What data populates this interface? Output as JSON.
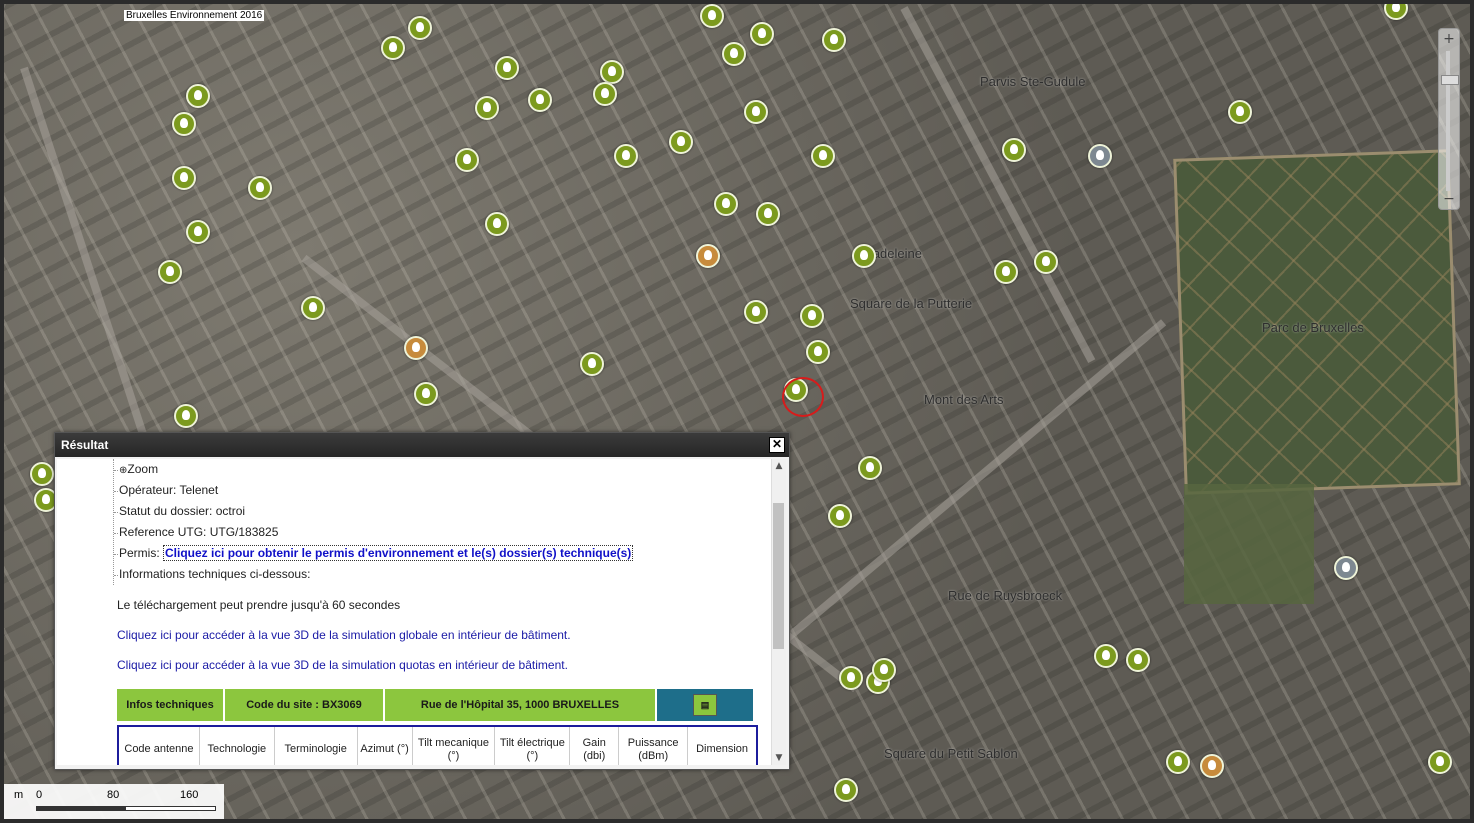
{
  "map": {
    "copyright": "Bruxelles Environnement 2016",
    "labels": [
      "Parvis Ste-Gudule",
      "Madeleine",
      "Square de la Putterie",
      "Parc de Bruxelles",
      "Mont des Arts",
      "Rue de Ruysbroeck",
      "Square du Petit Sablon"
    ],
    "scale": {
      "unit": "m",
      "ticks": [
        "0",
        "80",
        "160"
      ]
    },
    "zoom": {
      "plus": "+",
      "minus": "−"
    },
    "marker_colors": {
      "active": "#7c9a1e",
      "pending": "#c78b3c",
      "other": "#7d8891"
    },
    "selected_color": "#d81b1b"
  },
  "dialog": {
    "title": "Résultat",
    "close": "✕",
    "zoom": "Zoom",
    "operator": "Opérateur: Telenet",
    "status": "Statut du dossier: octroi",
    "reference": "Reference UTG: UTG/183825",
    "permis_label": "Permis:",
    "permis_link": "Cliquez ici pour obtenir le permis d'environnement et le(s) dossier(s) technique(s)",
    "info_label": "Informations techniques ci-dessous:",
    "download_note": "Le téléchargement peut prendre jusqu'à 60 secondes",
    "link_3d_global": "Cliquez ici pour accéder à la vue 3D de la simulation globale en intérieur de bâtiment.",
    "link_3d_quotas": "Cliquez ici pour accéder à la vue 3D de la simulation quotas en intérieur de bâtiment.",
    "info_header": {
      "title": "Infos techniques",
      "site_code": "Code du site : BX3069",
      "address": "Rue de l'Hôpital 35, 1000 BRUXELLES",
      "icon": "document-icon"
    },
    "table_columns": [
      "Code antenne",
      "Technologie",
      "Terminologie",
      "Azimut (°)",
      "Tilt mecanique (°)",
      "Tilt électrique (°)",
      "Gain (dbi)",
      "Puissance (dBm)",
      "Dimension"
    ]
  }
}
